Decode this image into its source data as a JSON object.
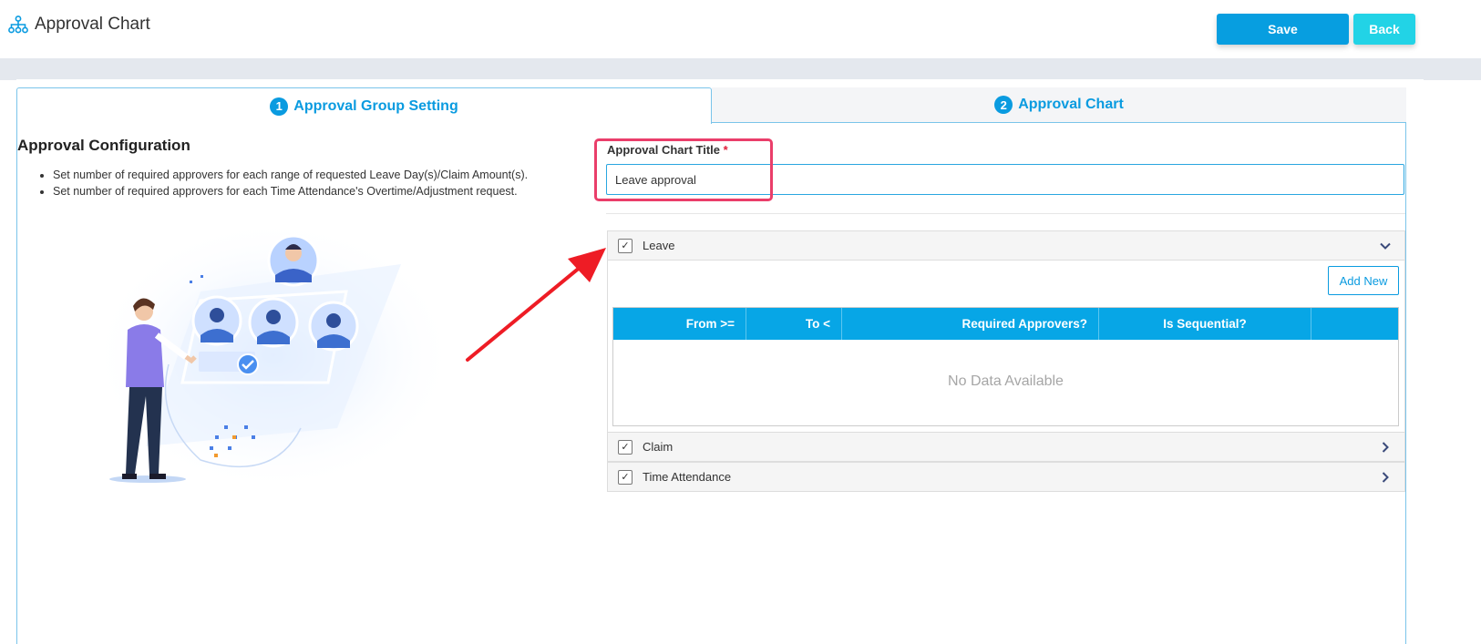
{
  "header": {
    "title": "Approval Chart",
    "save_label": "Save",
    "back_label": "Back"
  },
  "tabs": [
    {
      "number": "1",
      "label": "Approval Group Setting",
      "active": true
    },
    {
      "number": "2",
      "label": "Approval Chart",
      "active": false
    }
  ],
  "config": {
    "title": "Approval Configuration",
    "bullets": [
      "Set number of required approvers for each range of requested Leave Day(s)/Claim Amount(s).",
      "Set number of required approvers for each Time Attendance's Overtime/Adjustment request."
    ]
  },
  "form": {
    "title_label": "Approval Chart Title",
    "required_mark": "*",
    "title_value": "Leave approval"
  },
  "sections": {
    "leave": {
      "label": "Leave",
      "checked": true,
      "expanded": true
    },
    "claim": {
      "label": "Claim",
      "checked": true,
      "expanded": false
    },
    "time_attendance": {
      "label": "Time Attendance",
      "checked": true,
      "expanded": false
    }
  },
  "leave_table": {
    "add_new_label": "Add New",
    "columns": [
      "From >=",
      "To <",
      "Required Approvers?",
      "Is Sequential?",
      ""
    ],
    "empty_text": "No Data Available"
  },
  "colors": {
    "primary": "#079ee0",
    "secondary": "#22d3e6",
    "table_header": "#07a6e6",
    "highlight": "#ea3e6a",
    "annotation_arrow": "#ee1c25"
  }
}
